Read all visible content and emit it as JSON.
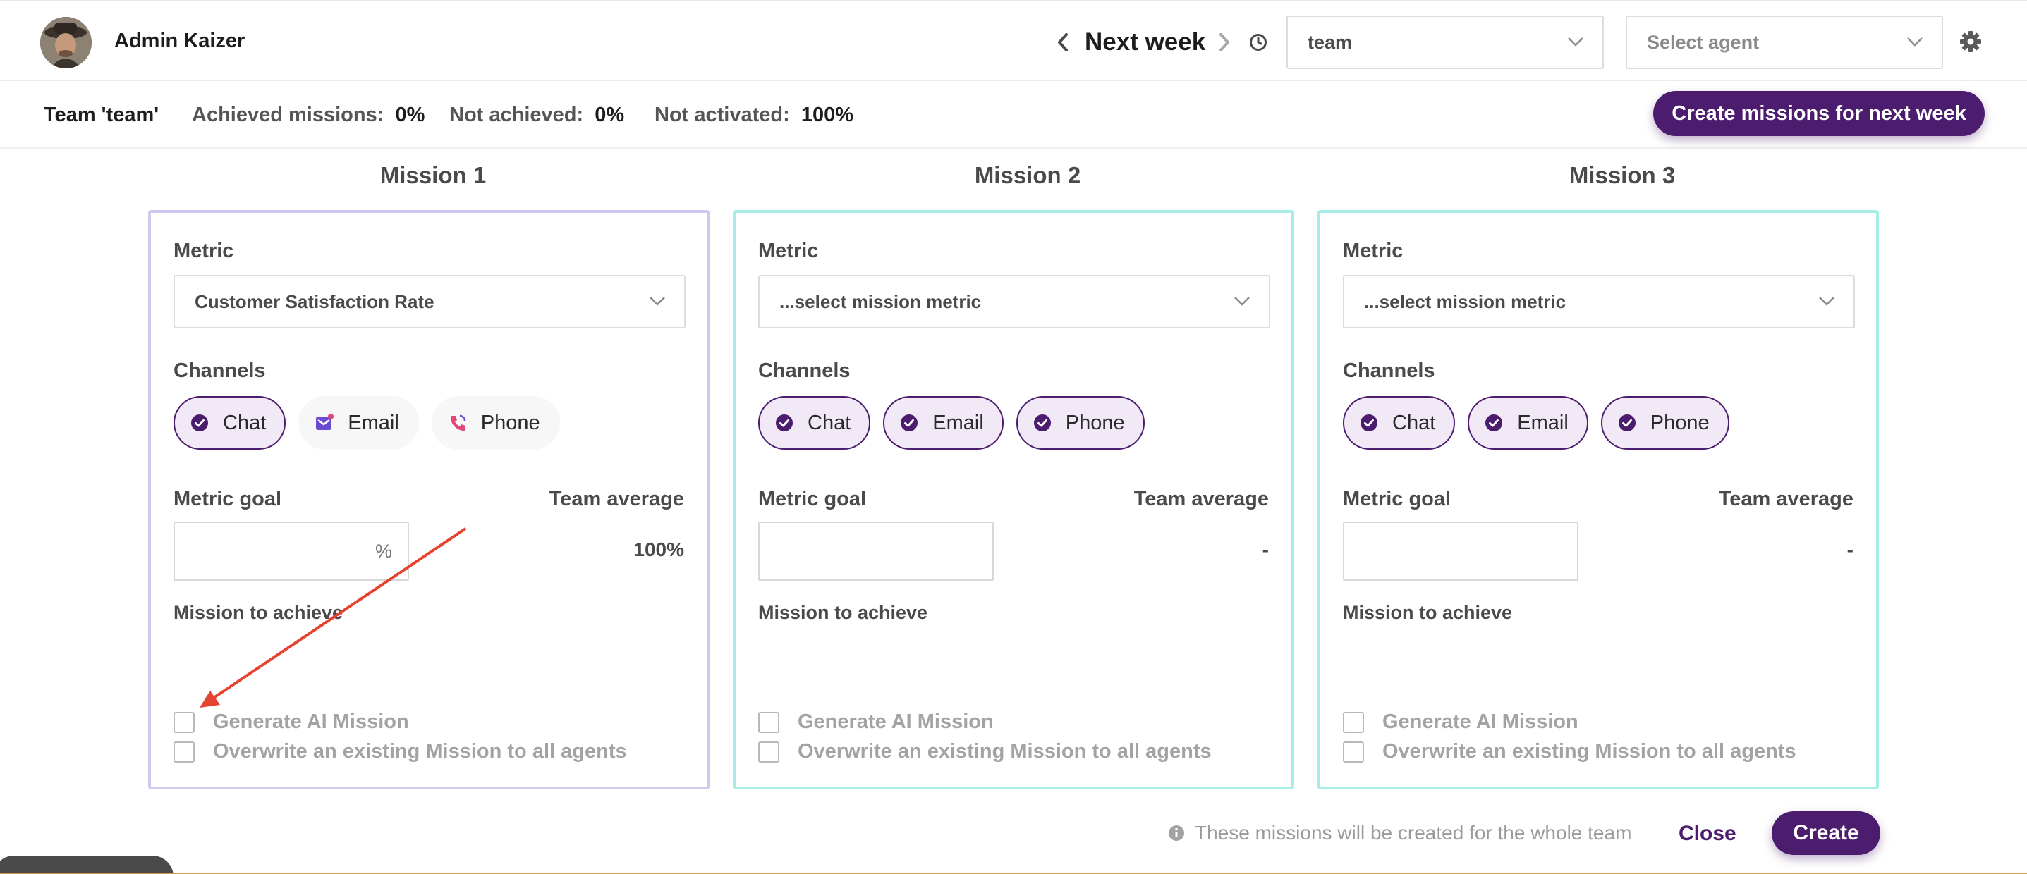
{
  "header": {
    "user_name": "Admin Kaizer",
    "week_label": "Next week",
    "team_select": "team",
    "agent_select": "Select agent"
  },
  "stats": {
    "team": "Team 'team'",
    "achieved_label": "Achieved missions:",
    "achieved_value": "0%",
    "not_achieved_label": "Not achieved:",
    "not_achieved_value": "0%",
    "not_activated_label": "Not activated:",
    "not_activated_value": "100%",
    "create_next_label": "Create missions for next week"
  },
  "labels": {
    "metric": "Metric",
    "channels": "Channels",
    "metric_goal": "Metric goal",
    "team_average": "Team average",
    "mission_to_achieve": "Mission to achieve",
    "generate_ai": "Generate AI Mission",
    "overwrite": "Overwrite an existing Mission to all agents"
  },
  "missions": [
    {
      "title": "Mission 1",
      "metric": "Customer Satisfaction Rate",
      "channels": [
        {
          "label": "Chat",
          "state": "checked"
        },
        {
          "label": "Email",
          "state": "unchecked"
        },
        {
          "label": "Phone",
          "state": "unchecked"
        }
      ],
      "goal_unit": "%",
      "team_average": "100%"
    },
    {
      "title": "Mission 2",
      "metric": "...select mission metric",
      "channels": [
        {
          "label": "Chat",
          "state": "checked"
        },
        {
          "label": "Email",
          "state": "checked"
        },
        {
          "label": "Phone",
          "state": "checked"
        }
      ],
      "goal_unit": "",
      "team_average": "-"
    },
    {
      "title": "Mission 3",
      "metric": "...select mission metric",
      "channels": [
        {
          "label": "Chat",
          "state": "checked"
        },
        {
          "label": "Email",
          "state": "checked"
        },
        {
          "label": "Phone",
          "state": "checked"
        }
      ],
      "goal_unit": "",
      "team_average": "-"
    }
  ],
  "footer": {
    "note": "These missions will be created for the whole team",
    "close_label": "Close",
    "create_label": "Create"
  },
  "colors": {
    "brand": "#4c1c6e",
    "chip_bg": "#f2e9f6",
    "card1_border": "#cfc8ef",
    "card_border": "#a6eee6",
    "annotation_arrow": "#e5432f"
  },
  "icons": {
    "check": "check-circle-icon",
    "email": "email-icon",
    "phone": "phone-icon",
    "chevron": "chevron-down-icon",
    "gear": "gear-icon",
    "history": "history-icon",
    "info": "info-icon"
  }
}
